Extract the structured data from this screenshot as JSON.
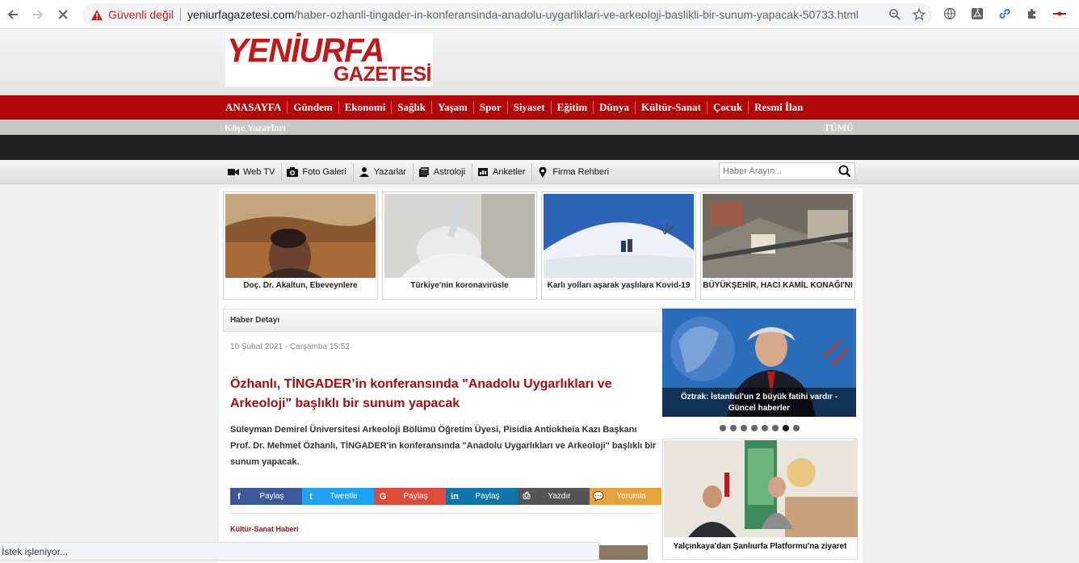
{
  "browser": {
    "security_label": "Güvenli değil",
    "url_host": "yeniurfagazetesi.com",
    "url_path": "/haber-ozhanli-tingader-in-konferansinda-anadolu-uygarliklari-ve-arkeoloji-baslikli-bir-sunum-yapacak-50733.html",
    "status_text": "İstek işleniyor..."
  },
  "logo": {
    "line1": "YENİURFA",
    "line2": "GAZETESİ",
    "color": "#c41818"
  },
  "menu": [
    {
      "label": "ANASAYFA"
    },
    {
      "label": "Gündem"
    },
    {
      "label": "Ekonomi"
    },
    {
      "label": "Sağlık"
    },
    {
      "label": "Yaşam"
    },
    {
      "label": "Spor"
    },
    {
      "label": "Siyaset"
    },
    {
      "label": "Eğitim"
    },
    {
      "label": "Dünya"
    },
    {
      "label": "Kültür-Sanat"
    },
    {
      "label": "Çocuk"
    },
    {
      "label": "Resmi İlan"
    }
  ],
  "kose": {
    "title": "Köşe Yazarları",
    "all": "TÜMÜ"
  },
  "tools": [
    {
      "label": "Web TV",
      "icon": "camera-icon"
    },
    {
      "label": "Foto Galeri",
      "icon": "photo-icon"
    },
    {
      "label": "Yazarlar",
      "icon": "person-icon"
    },
    {
      "label": "Astroloji",
      "icon": "book-icon"
    },
    {
      "label": "Anketler",
      "icon": "poll-icon"
    },
    {
      "label": "Firma Rehberi",
      "icon": "location-icon"
    }
  ],
  "search": {
    "placeholder": "Haber Arayın..."
  },
  "cards": [
    {
      "caption": "Doç. Dr. Akaltun, Ebeveynlere"
    },
    {
      "caption": "Türkiye'nin koronavirüsle"
    },
    {
      "caption": "Karlı yolları aşarak yaşlılara Kovid-19"
    },
    {
      "caption": "BÜYÜKŞEHİR, HACI KAMİL KONAĞI'NI"
    }
  ],
  "article": {
    "section": "Haber Detayı",
    "date": "10 Şubat 2021 - Çarşamba 15:52",
    "title": "Özhanlı, TİNGADER’in konferansında \"Anadolu Uygarlıkları ve Arkeoloji\" başlıklı bir sunum yapacak",
    "summary": "Süleyman Demirel Üniversitesi Arkeoloji Bölümü Öğretim Üyesi, Pisidia Antiokheia Kazı Başkanı Prof. Dr. Mehmet Özhanlı, TİNGADER'in konferansında \"Anadolu Uygarlıkları ve Arkeoloji\" başlıklı bir sunum yapacak.",
    "category": "Kültür-Sanat Haberi"
  },
  "share": [
    {
      "icon": "f",
      "label": "Paylaş",
      "cls": "s-fb"
    },
    {
      "icon": "t",
      "label": "Tweetle",
      "cls": "s-tw"
    },
    {
      "icon": "G",
      "label": "Paylaş",
      "cls": "s-gp"
    },
    {
      "icon": "in",
      "label": "Paylaş",
      "cls": "s-li"
    },
    {
      "icon": "⎙",
      "label": "Yazdır",
      "cls": "s-pr"
    },
    {
      "icon": "💬",
      "label": "Yorumla",
      "cls": "s-cm"
    }
  ],
  "slider": {
    "caption": "Öztrak: İstanbul'un 2 büyük fatihi vardır - Güncel haberler",
    "dot_count": 8,
    "active_dot": 6
  },
  "news2": {
    "caption": "Yalçınkaya'dan Şanlıurfa Platformu'na ziyaret"
  }
}
